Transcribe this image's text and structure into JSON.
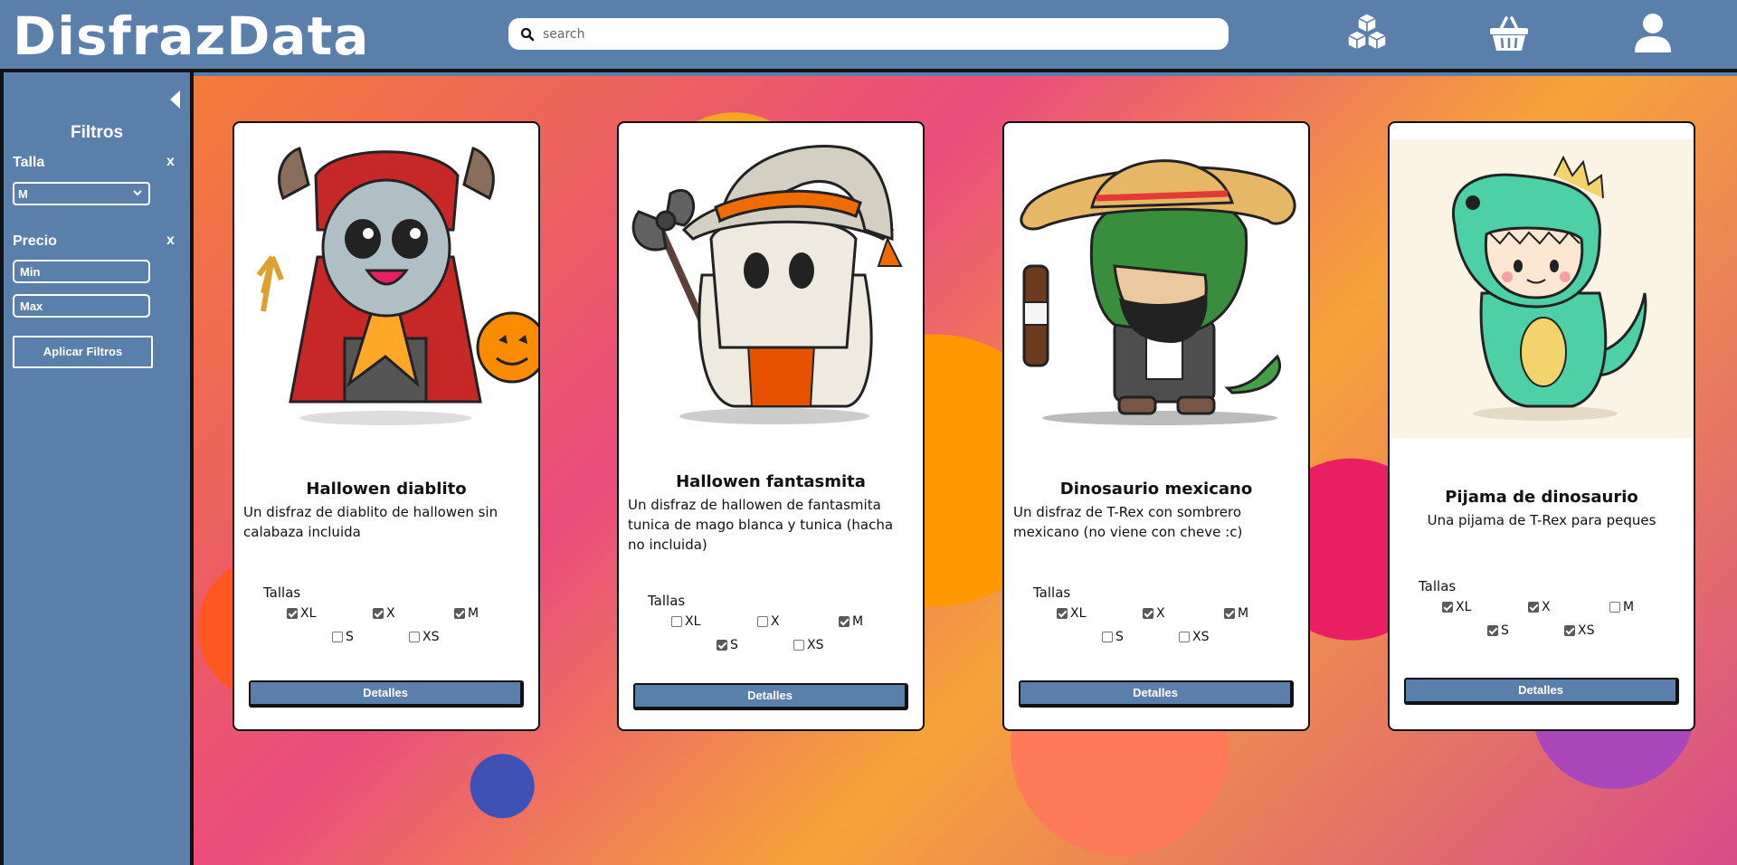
{
  "header": {
    "logo": "DisfrazData",
    "search_placeholder": "search",
    "icons": [
      "cubes-icon",
      "basket-icon",
      "user-icon"
    ]
  },
  "sidebar": {
    "title": "Filtros",
    "talla_label": "Talla",
    "talla_clear": "x",
    "talla_selected": "M",
    "precio_label": "Precio",
    "precio_clear": "x",
    "min_placeholder": "Min",
    "max_placeholder": "Max",
    "apply_label": "Aplicar Filtros"
  },
  "cards": [
    {
      "title": "Hallowen diablito",
      "description": "Un disfraz de diablito de hallowen sin calabaza incluida",
      "tallas_label": "Tallas",
      "sizes": [
        {
          "label": "XL",
          "checked": true
        },
        {
          "label": "X",
          "checked": true
        },
        {
          "label": "M",
          "checked": true
        },
        {
          "label": "S",
          "checked": false
        },
        {
          "label": "XS",
          "checked": false
        }
      ],
      "button": "Detalles"
    },
    {
      "title": "Hallowen fantasmita",
      "description": "Un disfraz de hallowen de fantasmita tunica de mago blanca y tunica (hacha no incluida)",
      "tallas_label": "Tallas",
      "sizes": [
        {
          "label": "XL",
          "checked": false
        },
        {
          "label": "X",
          "checked": false
        },
        {
          "label": "M",
          "checked": true
        },
        {
          "label": "S",
          "checked": true
        },
        {
          "label": "XS",
          "checked": false
        }
      ],
      "button": "Detalles"
    },
    {
      "title": "Dinosaurio mexicano",
      "description": "Un disfraz de T-Rex con sombrero mexicano (no viene con cheve :c)",
      "tallas_label": "Tallas",
      "sizes": [
        {
          "label": "XL",
          "checked": true
        },
        {
          "label": "X",
          "checked": true
        },
        {
          "label": "M",
          "checked": true
        },
        {
          "label": "S",
          "checked": false
        },
        {
          "label": "XS",
          "checked": false
        }
      ],
      "button": "Detalles"
    },
    {
      "title": "Pijama de dinosaurio",
      "description": "Una pijama de T-Rex para peques",
      "tallas_label": "Tallas",
      "sizes": [
        {
          "label": "XL",
          "checked": true
        },
        {
          "label": "X",
          "checked": true
        },
        {
          "label": "M",
          "checked": false
        },
        {
          "label": "S",
          "checked": true
        },
        {
          "label": "XS",
          "checked": true
        }
      ],
      "button": "Detalles"
    }
  ],
  "colors": {
    "primary": "#5b7fab",
    "border": "#111111"
  }
}
